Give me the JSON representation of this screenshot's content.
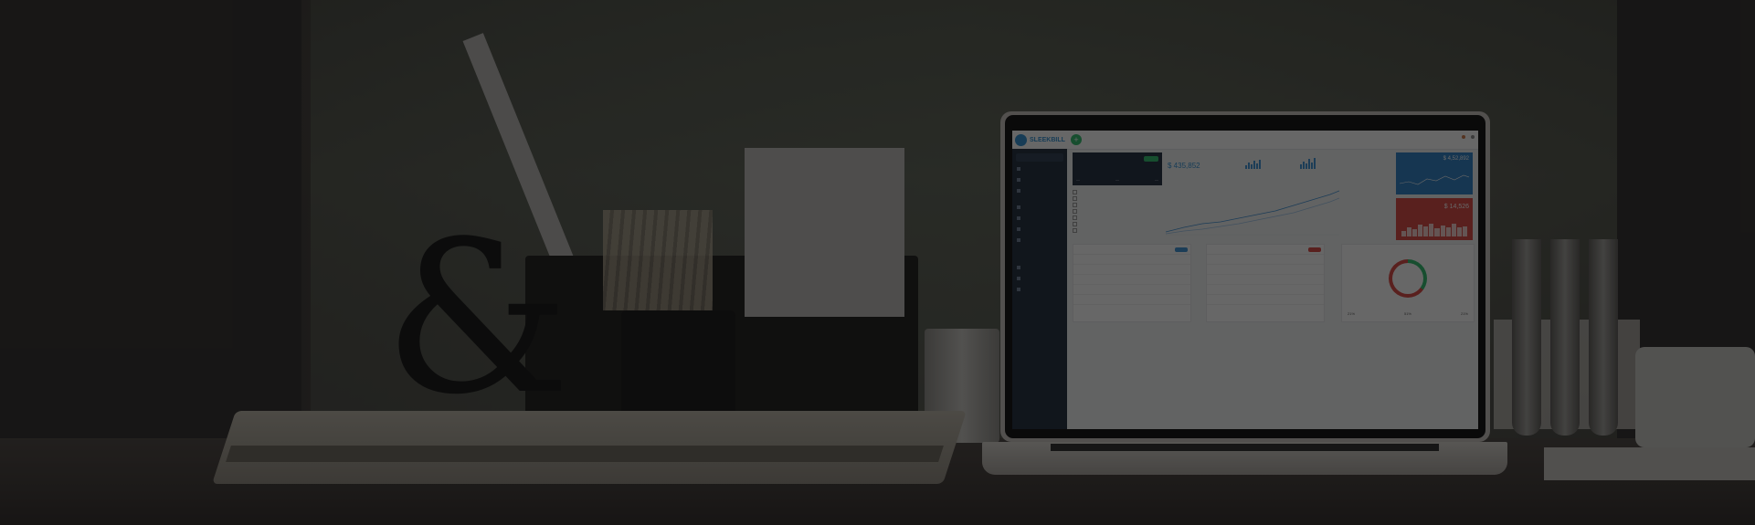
{
  "scene": {
    "description_objects": [
      "desk-organizer",
      "ampersand-sculpture",
      "open-notebook",
      "laptop",
      "tin-can",
      "test-tubes",
      "coffee-mug"
    ]
  },
  "laptop_screen": {
    "brand": "SLEEKBILL",
    "add_icon": "+",
    "sidebar": {
      "items": [
        "",
        "",
        "",
        "",
        "",
        "",
        "",
        "",
        "",
        "",
        ""
      ]
    },
    "card_revenue": {
      "value": "$ 435,852"
    },
    "card_blue": {
      "value": "$ 4,52,892"
    },
    "card_red": {
      "value": "$ 14,526"
    },
    "summary": {
      "pct1": "21%",
      "pct2": "51%",
      "pct3": "21%"
    },
    "colors": {
      "brand": "#2d8fd1",
      "sidebar": "#1d2a3b",
      "success": "#2ebd6d",
      "danger": "#d9443f",
      "blue_card": "#2c7fc4"
    }
  }
}
